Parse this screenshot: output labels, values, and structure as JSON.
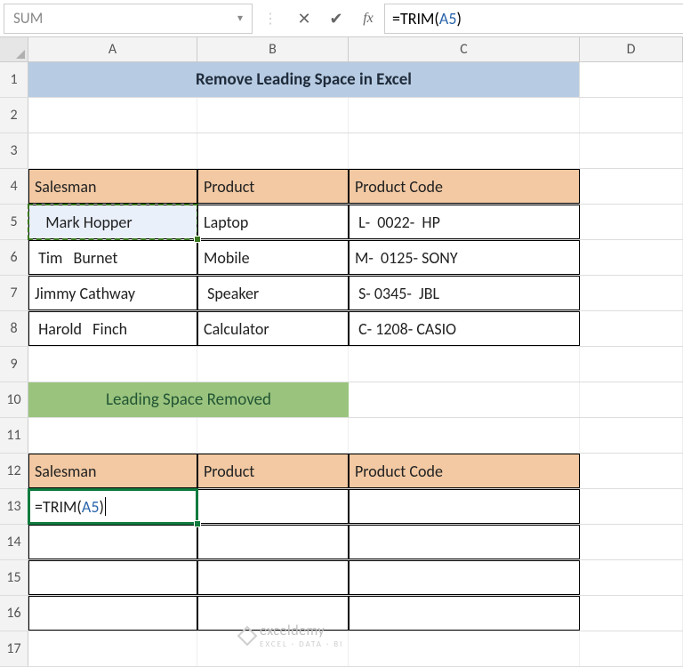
{
  "formula_bar": {
    "name_box": "SUM",
    "formula_prefix": "=TRIM(",
    "formula_ref": "A5",
    "formula_suffix": ")"
  },
  "columns": [
    "A",
    "B",
    "C",
    "D"
  ],
  "row_numbers": [
    "1",
    "2",
    "3",
    "4",
    "5",
    "6",
    "7",
    "8",
    "9",
    "10",
    "11",
    "12",
    "13",
    "14",
    "15",
    "16",
    "17"
  ],
  "title": "Remove Leading Space in Excel",
  "subtitle": "Leading Space Removed",
  "headers": {
    "salesman": "Salesman",
    "product": "Product",
    "code": "Product Code"
  },
  "table1": [
    {
      "salesman": "   Mark Hopper",
      "product": "Laptop",
      "code": " L-  0022-  HP"
    },
    {
      "salesman": " Tim   Burnet",
      "product": "Mobile",
      "code": "M-  0125- SONY"
    },
    {
      "salesman": "Jimmy Cathway",
      "product": " Speaker",
      "code": " S- 0345-  JBL"
    },
    {
      "salesman": " Harold   Finch",
      "product": "Calculator",
      "code": " C- 1208- CASIO"
    }
  ],
  "editing_cell": {
    "prefix": "=TRIM(",
    "ref": "A5",
    "suffix": ")"
  },
  "watermark": {
    "brand": "exceldemy",
    "tag": "EXCEL · DATA · BI"
  }
}
